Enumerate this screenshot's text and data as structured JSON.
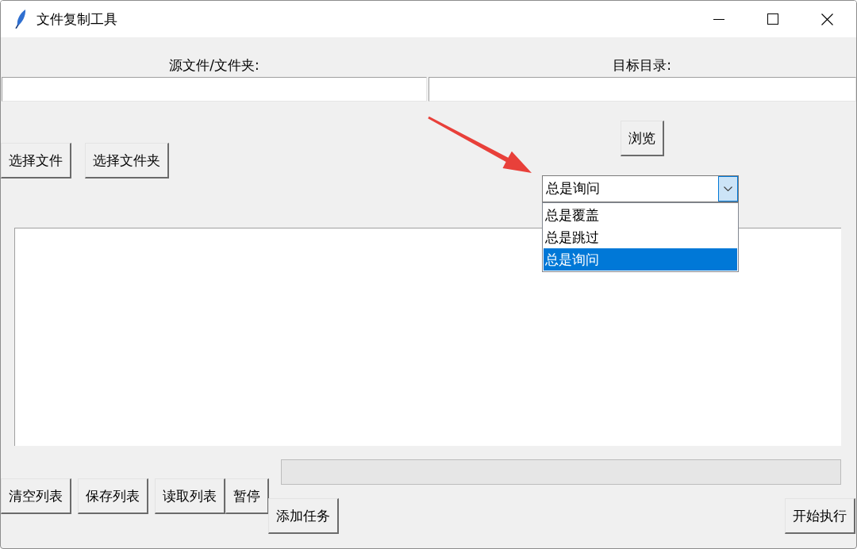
{
  "window": {
    "title": "文件复制工具"
  },
  "source": {
    "label": "源文件/文件夹:"
  },
  "target": {
    "label": "目标目录:"
  },
  "source_buttons": [
    "选择文件",
    "选择文件夹"
  ],
  "browse_button": "浏览",
  "mode_combobox": {
    "value": "总是询问",
    "expanded": true,
    "options": [
      {
        "label": "总是覆盖",
        "selected": false
      },
      {
        "label": "总是跳过",
        "selected": false
      },
      {
        "label": "总是询问",
        "selected": true
      }
    ]
  },
  "progress": {
    "level": 0
  },
  "list_buttons": [
    "清空列表",
    "保存列表",
    "读取列表",
    "暂停"
  ],
  "add_task_button": "添加任务",
  "start_button": "开始执行"
}
